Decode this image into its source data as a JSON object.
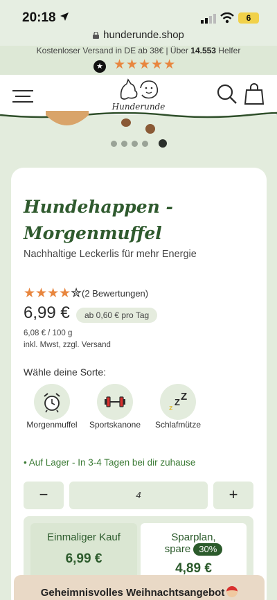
{
  "status_bar": {
    "time": "20:18",
    "battery": "6"
  },
  "browser": {
    "url": "hunderunde.shop"
  },
  "promo": {
    "text_prefix": "Kostenloser Versand in DE ab 38€ | Über ",
    "helper_count": "14.553",
    "text_suffix": " Helfer",
    "stars": "★★★★★"
  },
  "header": {
    "logo_text": "Hunderunde"
  },
  "carousel": {
    "dots": 5,
    "active_index": 4
  },
  "product": {
    "title": "Hundehappen - Morgenmuffel",
    "subtitle": "Nachhaltige Leckerlis für mehr Energie",
    "rating": 4.5,
    "rating_text": "(2 Bewertungen)",
    "price": "6,99 €",
    "per_day": "ab 0,60 € pro Tag",
    "base_price": "6,08 € / 100 g",
    "tax_note": "inkl. Mwst, zzgl. Versand"
  },
  "variants": {
    "label": "Wähle deine Sorte:",
    "items": [
      {
        "label": "Morgenmuffel",
        "icon": "alarm-clock-icon"
      },
      {
        "label": "Sportskanone",
        "icon": "dumbbell-icon"
      },
      {
        "label": "Schlafmütze",
        "icon": "zzz-icon"
      }
    ]
  },
  "stock": {
    "text": "• Auf Lager - In 3-4 Tagen bei dir zuhause"
  },
  "quantity": {
    "minus": "−",
    "value": "4",
    "plus": "+"
  },
  "plans": {
    "once": {
      "label": "Einmaliger Kauf",
      "price": "6,99 €"
    },
    "subscription": {
      "label": "Sparplan, spare",
      "discount": "30%",
      "price": "4,89 €"
    }
  },
  "banner": {
    "text": "Geheimnisvolles Weihnachtsangebot"
  },
  "colors": {
    "brand_green": "#2c5b2c",
    "accent_orange": "#e8863f",
    "background": "#e3ecdd"
  }
}
